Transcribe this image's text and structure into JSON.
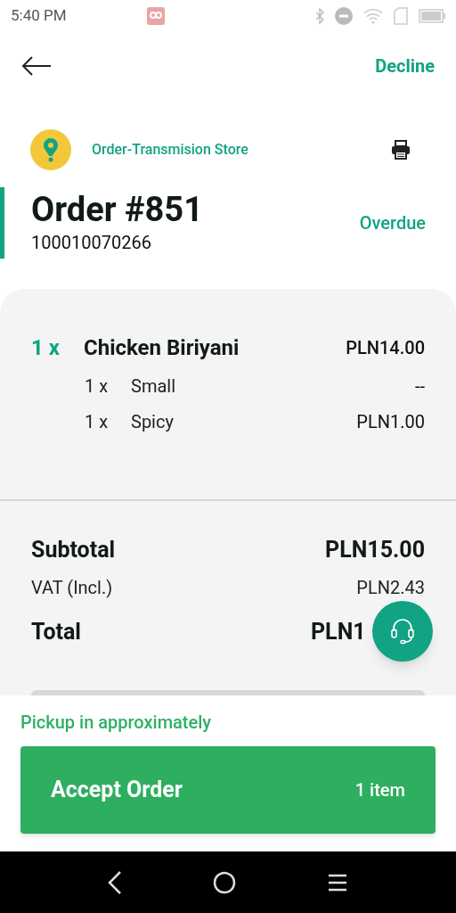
{
  "status_bar": {
    "time": "5:40 PM"
  },
  "header": {
    "decline": "Decline"
  },
  "store": {
    "name": "Order-Transmision Store"
  },
  "order": {
    "title": "Order #851",
    "number": "100010070266",
    "status": "Overdue"
  },
  "items": [
    {
      "qty": "1 x",
      "name": "Chicken Biriyani",
      "price": "PLN14.00",
      "options": [
        {
          "qty": "1 x",
          "name": "Small",
          "price": "--"
        },
        {
          "qty": "1 x",
          "name": "Spicy",
          "price": "PLN1.00"
        }
      ]
    }
  ],
  "totals": [
    {
      "kind": "major",
      "label": "Subtotal",
      "value": "PLN15.00"
    },
    {
      "kind": "minor",
      "label": "VAT (Incl.)",
      "value": "PLN2.43"
    },
    {
      "kind": "major",
      "label": "Total",
      "value": "PLN1"
    }
  ],
  "pickup": "Pickup in approximately",
  "accept": {
    "label": "Accept Order",
    "count": "1 item"
  }
}
